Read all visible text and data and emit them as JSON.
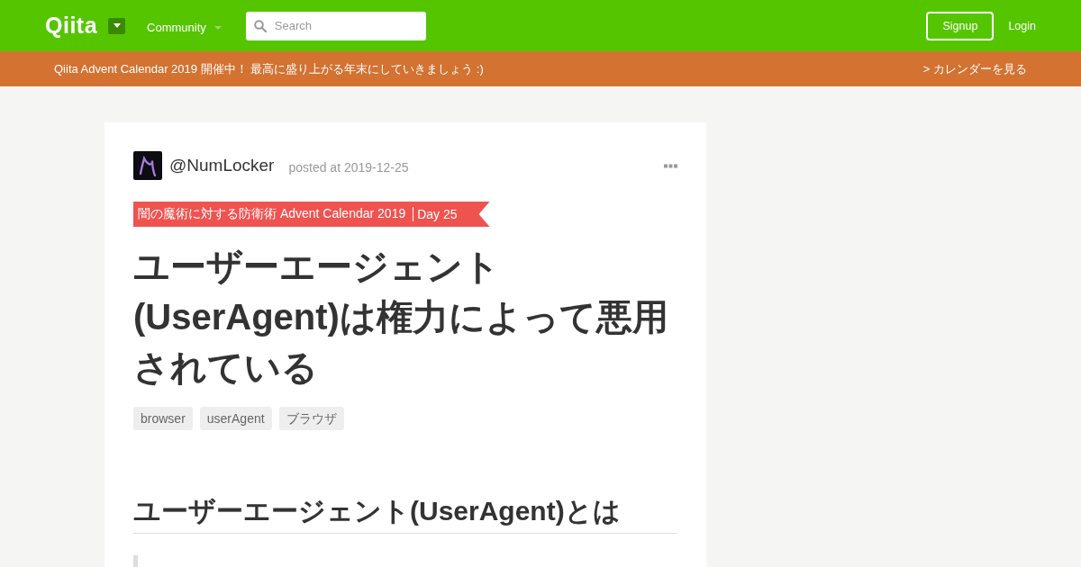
{
  "header": {
    "logo": "Qiita",
    "community_menu": "Community",
    "search": {
      "placeholder": "Search"
    },
    "signup": "Signup",
    "login": "Login"
  },
  "banner": {
    "message": "Qiita Advent Calendar 2019 開催中！ 最高に盛り上がる年末にしていきましょう :)",
    "link": "> カレンダーを見る"
  },
  "article": {
    "author": "@NumLocker",
    "posted": "posted at 2019-12-25",
    "calendar": {
      "name": "闇の魔術に対する防衛術 Advent Calendar 2019",
      "day": "Day 25"
    },
    "title": "ユーザーエージェント(UserAgent)は権力によって悪用されている",
    "tags": [
      "browser",
      "userAgent",
      "ブラウザ"
    ],
    "heading": "ユーザーエージェント(UserAgent)とは"
  }
}
